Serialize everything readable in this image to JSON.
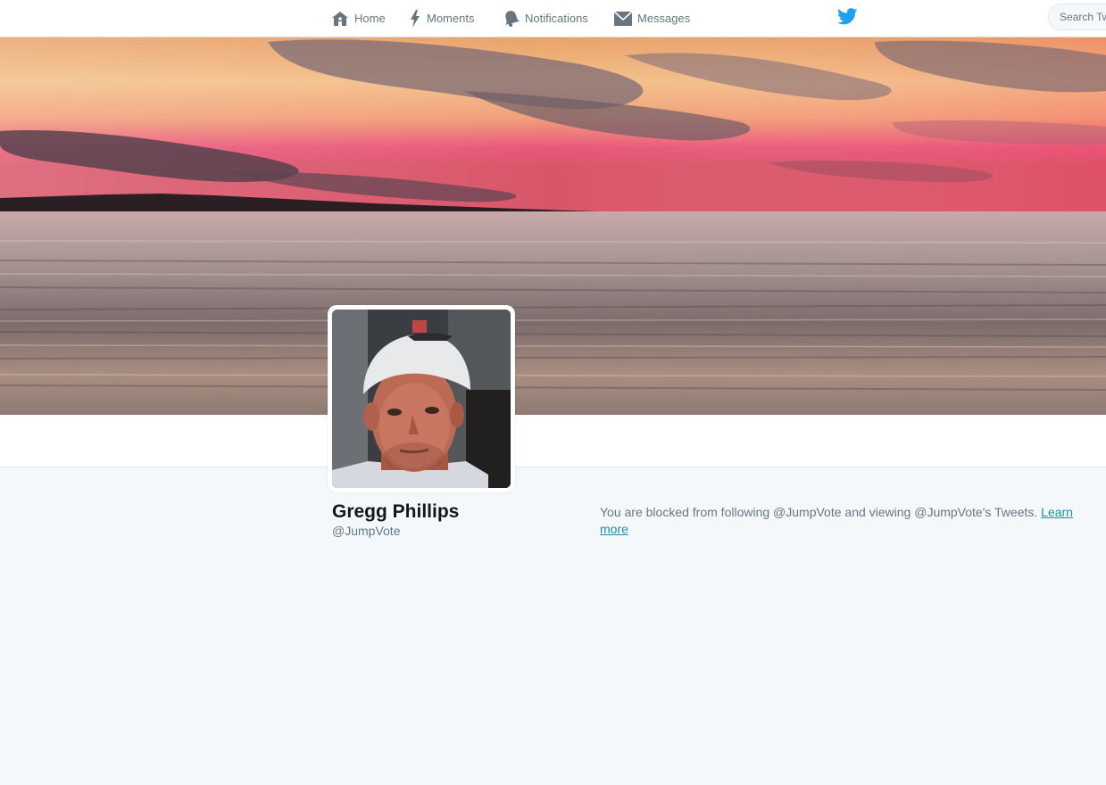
{
  "nav": {
    "home_label": "Home",
    "moments_label": "Moments",
    "notifications_label": "Notifications",
    "messages_label": "Messages"
  },
  "search": {
    "placeholder": "Search Twitter"
  },
  "profile": {
    "name": "Gregg Phillips",
    "handle": "@JumpVote"
  },
  "notice": {
    "text": "You are blocked from following @JumpVote and viewing @JumpVote's Tweets.",
    "link_label": "Learn more"
  },
  "colors": {
    "brand": "#1da1f2",
    "page_background": "#f5f8fa",
    "link": "#1d8ea5"
  },
  "icons": {
    "home": "home-icon",
    "moments": "lightning-icon",
    "notifications": "bell-icon",
    "messages": "envelope-icon",
    "logo": "twitter-bird-icon"
  }
}
